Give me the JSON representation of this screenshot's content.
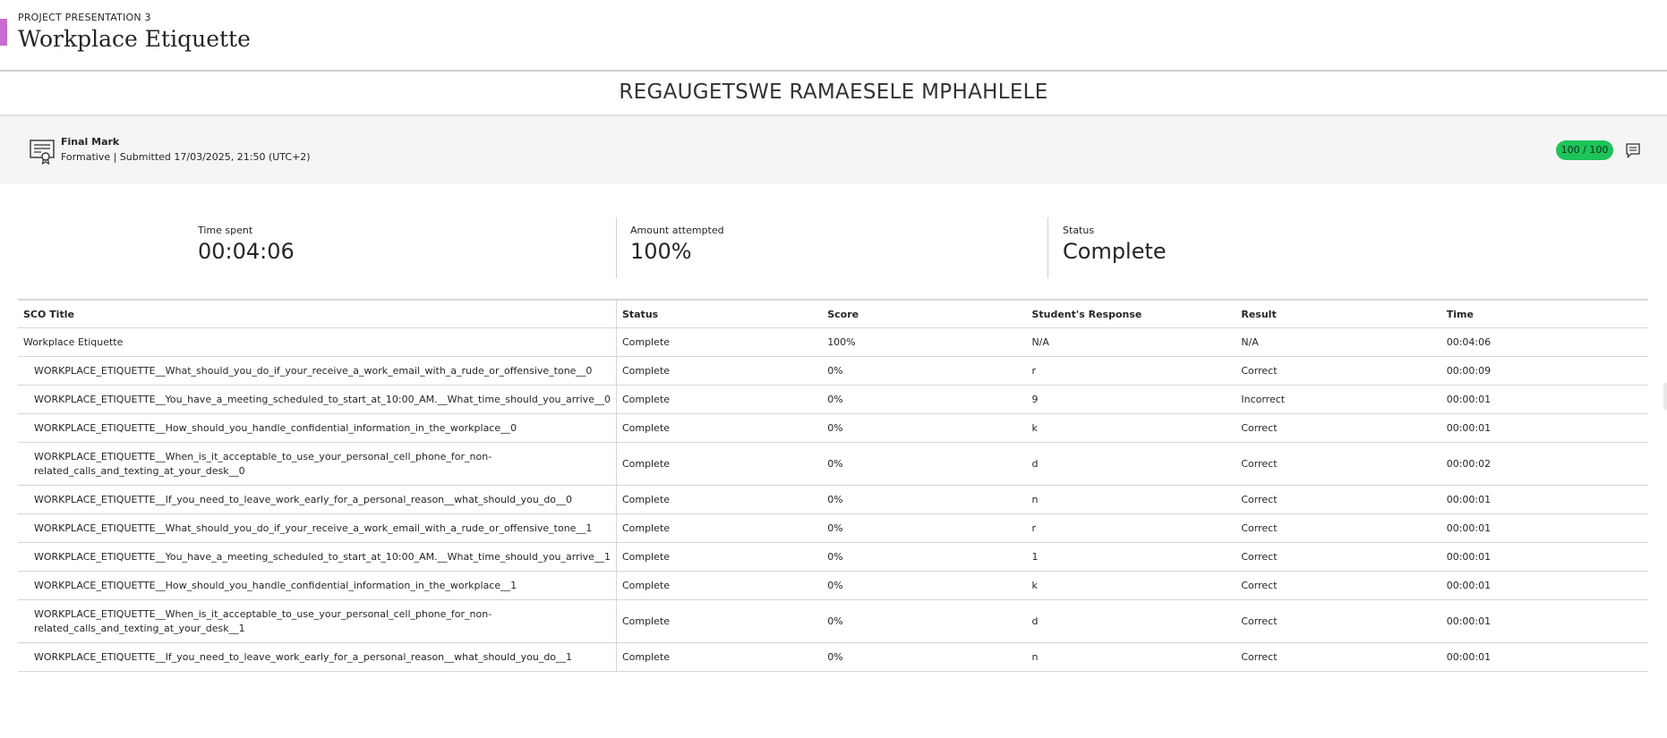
{
  "header": {
    "breadcrumb": "PROJECT PRESENTATION 3",
    "title": "Workplace Etiquette",
    "accent_color": "#c86bcf"
  },
  "student": {
    "name": "REGAUGETSWE RAMAESELE MPHAHLELE"
  },
  "final_mark": {
    "icon": "certificate-icon",
    "label": "Final Mark",
    "details": "Formative | Submitted 17/03/2025, 21:50 (UTC+2)",
    "grade": "100 / 100",
    "grade_color": "#1ec45a",
    "feedback_icon": "comment-icon"
  },
  "stats": {
    "time_spent": {
      "label": "Time spent",
      "value": "00:04:06"
    },
    "amount_attempted": {
      "label": "Amount attempted",
      "value": "100%"
    },
    "status": {
      "label": "Status",
      "value": "Complete"
    }
  },
  "table": {
    "headers": [
      "SCO Title",
      "Status",
      "Score",
      "Student's Response",
      "Result",
      "Time"
    ],
    "rows": [
      [
        "Workplace Etiquette",
        "Complete",
        "100%",
        "N/A",
        "N/A",
        "00:04:06"
      ],
      [
        "WORKPLACE_ETIQUETTE__What_should_you_do_if_your_receive_a_work_email_with_a_rude_or_offensive_tone__0",
        "Complete",
        "0%",
        "r",
        "Correct",
        "00:00:09"
      ],
      [
        "WORKPLACE_ETIQUETTE__You_have_a_meeting_scheduled_to_start_at_10:00_AM.__What_time_should_you_arrive__0",
        "Complete",
        "0%",
        "9",
        "Incorrect",
        "00:00:01"
      ],
      [
        "WORKPLACE_ETIQUETTE__How_should_you_handle_confidential_information_in_the_workplace__0",
        "Complete",
        "0%",
        "k",
        "Correct",
        "00:00:01"
      ],
      [
        "WORKPLACE_ETIQUETTE__When_is_it_acceptable_to_use_your_personal_cell_phone_for_non-related_calls_and_texting_at_your_desk__0",
        "Complete",
        "0%",
        "d",
        "Correct",
        "00:00:02"
      ],
      [
        "WORKPLACE_ETIQUETTE__If_you_need_to_leave_work_early_for_a_personal_reason__what_should_you_do__0",
        "Complete",
        "0%",
        "n",
        "Correct",
        "00:00:01"
      ],
      [
        "WORKPLACE_ETIQUETTE__What_should_you_do_if_your_receive_a_work_email_with_a_rude_or_offensive_tone__1",
        "Complete",
        "0%",
        "r",
        "Correct",
        "00:00:01"
      ],
      [
        "WORKPLACE_ETIQUETTE__You_have_a_meeting_scheduled_to_start_at_10:00_AM.__What_time_should_you_arrive__1",
        "Complete",
        "0%",
        "1",
        "Correct",
        "00:00:01"
      ],
      [
        "WORKPLACE_ETIQUETTE__How_should_you_handle_confidential_information_in_the_workplace__1",
        "Complete",
        "0%",
        "k",
        "Correct",
        "00:00:01"
      ],
      [
        "WORKPLACE_ETIQUETTE__When_is_it_acceptable_to_use_your_personal_cell_phone_for_non-related_calls_and_texting_at_your_desk__1",
        "Complete",
        "0%",
        "d",
        "Correct",
        "00:00:01"
      ],
      [
        "WORKPLACE_ETIQUETTE__If_you_need_to_leave_work_early_for_a_personal_reason__what_should_you_do__1",
        "Complete",
        "0%",
        "n",
        "Correct",
        "00:00:01"
      ]
    ]
  }
}
